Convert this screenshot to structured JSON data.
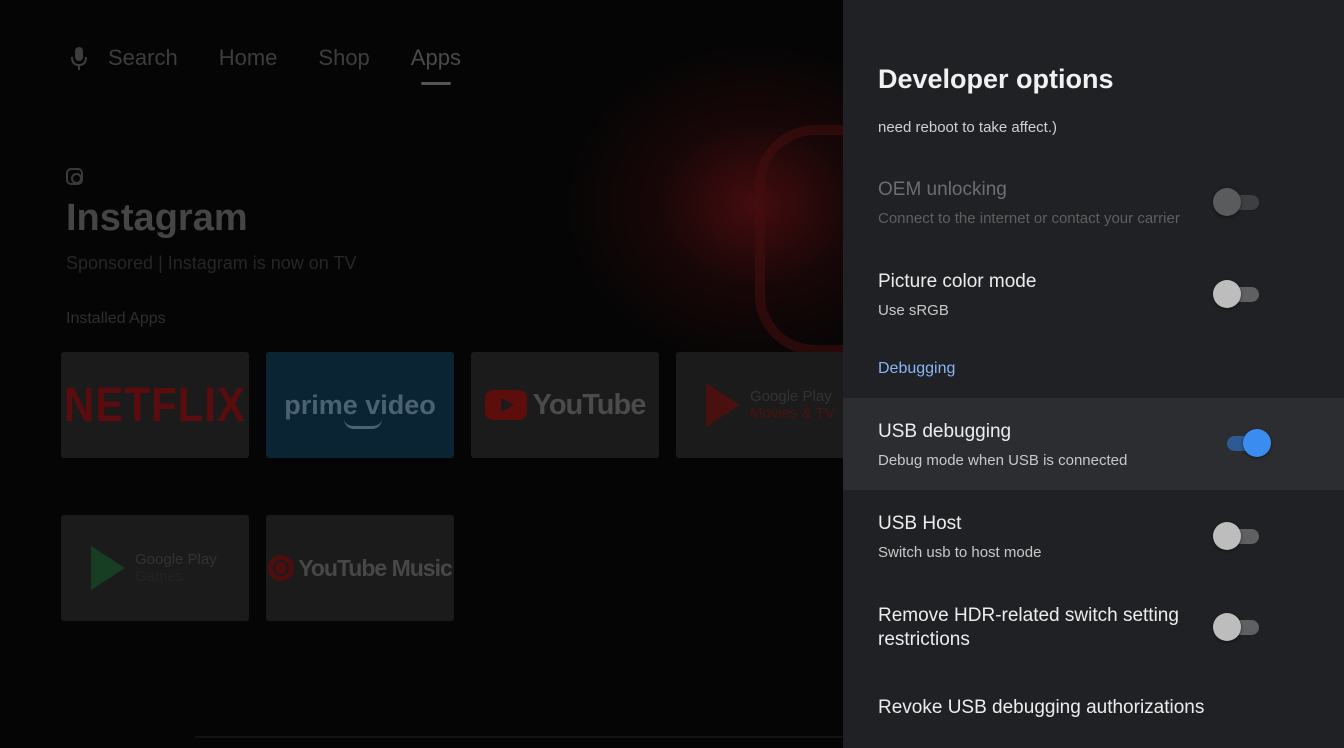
{
  "launcher": {
    "nav": {
      "search_label": "Search",
      "tabs": [
        {
          "label": "Home"
        },
        {
          "label": "Shop"
        },
        {
          "label": "Apps",
          "active": true
        }
      ]
    },
    "featured": {
      "title": "Instagram",
      "subtitle": "Sponsored | Instagram is now on TV"
    },
    "section_label": "Installed Apps",
    "apps_row1": [
      {
        "name": "Netflix",
        "logo_text": "NETFLIX"
      },
      {
        "name": "Prime Video",
        "logo_text": "prime video"
      },
      {
        "name": "YouTube",
        "logo_text": "YouTube"
      },
      {
        "name": "Google Play Movies & TV",
        "line1": "Google Play",
        "line2": "Movies & TV"
      }
    ],
    "apps_row2": [
      {
        "name": "Google Play Games",
        "line1": "Google Play",
        "line2": "Games"
      },
      {
        "name": "YouTube Music",
        "logo_text": "YouTube Music"
      }
    ]
  },
  "panel": {
    "title": "Developer options",
    "truncated_text": "need reboot to take affect.)",
    "items": [
      {
        "title": "OEM unlocking",
        "subtitle": "Connect to the internet or contact your carrier",
        "toggle": "off",
        "enabled": false
      },
      {
        "title": "Picture color mode",
        "subtitle": "Use sRGB",
        "toggle": "off",
        "enabled": true
      },
      {
        "title": "USB debugging",
        "subtitle": "Debug mode when USB is connected",
        "toggle": "on",
        "enabled": true,
        "focused": true
      },
      {
        "title": "USB Host",
        "subtitle": "Switch usb to host mode",
        "toggle": "off",
        "enabled": true
      },
      {
        "title": "Remove HDR-related switch setting restrictions",
        "toggle": "off",
        "enabled": true
      },
      {
        "title": "Revoke USB debugging authorizations"
      }
    ],
    "category_debugging": "Debugging"
  },
  "colors": {
    "panel_bg": "#202124",
    "accent": "#8ab4f8",
    "toggle_on": "#3b8cf0"
  }
}
